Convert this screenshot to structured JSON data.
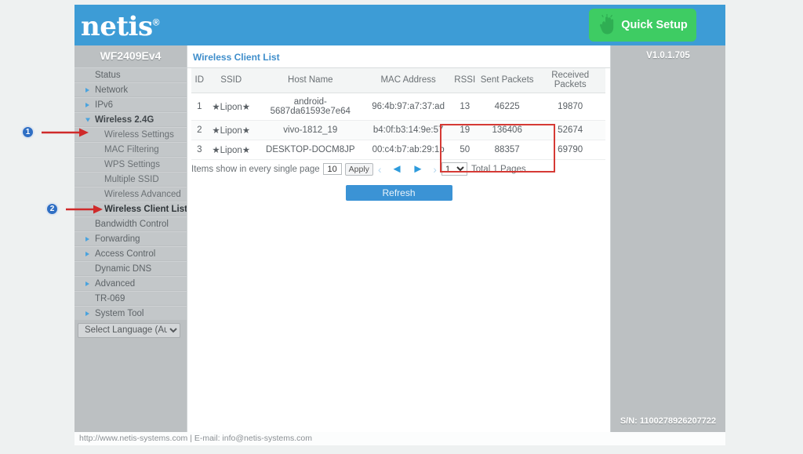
{
  "header": {
    "brand": "netis",
    "brand_tm": "®",
    "quick_setup_label": "Quick Setup",
    "quick_setup_icon": "hand-click-icon",
    "brand_color": "#3d9cd6",
    "quick_setup_color": "#3ecc63"
  },
  "sidebar": {
    "model": "WF2409Ev4",
    "items": [
      {
        "label": "Status",
        "type": "plain"
      },
      {
        "label": "Network",
        "type": "collapsed"
      },
      {
        "label": "IPv6",
        "type": "collapsed"
      },
      {
        "label": "Wireless 2.4G",
        "type": "expanded"
      },
      {
        "label": "Wireless Settings",
        "type": "sub"
      },
      {
        "label": "MAC Filtering",
        "type": "sub"
      },
      {
        "label": "WPS Settings",
        "type": "sub"
      },
      {
        "label": "Multiple SSID",
        "type": "sub"
      },
      {
        "label": "Wireless Advanced",
        "type": "sub"
      },
      {
        "label": "Wireless Client List",
        "type": "sub-active"
      },
      {
        "label": "Bandwidth Control",
        "type": "plain"
      },
      {
        "label": "Forwarding",
        "type": "collapsed"
      },
      {
        "label": "Access Control",
        "type": "collapsed"
      },
      {
        "label": "Dynamic DNS",
        "type": "plain"
      },
      {
        "label": "Advanced",
        "type": "collapsed"
      },
      {
        "label": "TR-069",
        "type": "plain"
      },
      {
        "label": "System Tool",
        "type": "collapsed"
      }
    ],
    "language_selected": "Select Language (Auto)"
  },
  "main": {
    "panel_title": "Wireless Client List",
    "table": {
      "columns": [
        "ID",
        "SSID",
        "Host Name",
        "MAC Address",
        "RSSI",
        "Sent Packets",
        "Received Packets"
      ],
      "rows": [
        {
          "id": "1",
          "ssid": "★Lipon★",
          "host": "android-5687da61593e7e64",
          "mac": "96:4b:97:a7:37:ad",
          "rssi": "13",
          "sent": "46225",
          "received": "19870"
        },
        {
          "id": "2",
          "ssid": "★Lipon★",
          "host": "vivo-1812_19",
          "mac": "b4:0f:b3:14:9e:57",
          "rssi": "19",
          "sent": "136406",
          "received": "52674"
        },
        {
          "id": "3",
          "ssid": "★Lipon★",
          "host": "DESKTOP-DOCM8JP",
          "mac": "00:c4:b7:ab:29:1b",
          "rssi": "50",
          "sent": "88357",
          "received": "69790"
        }
      ]
    },
    "pager": {
      "items_label": "Items show in every single page",
      "items_value": "10",
      "apply_label": "Apply",
      "first_icon": "‹",
      "prev_icon": "◄",
      "next_icon": "►",
      "last_icon": "›",
      "page_value": "1",
      "total_label": "Total 1 Pages"
    },
    "refresh_label": "Refresh",
    "highlight_color": "#d63a35"
  },
  "rightcol": {
    "version": "V1.0.1.705",
    "serial": "S/N: 1100278926207722"
  },
  "footer": {
    "text": "http://www.netis-systems.com | E-mail: info@netis-systems.com"
  },
  "annotations": [
    {
      "number": "1",
      "target": "Wireless 2.4G"
    },
    {
      "number": "2",
      "target": "Wireless Client List"
    }
  ]
}
